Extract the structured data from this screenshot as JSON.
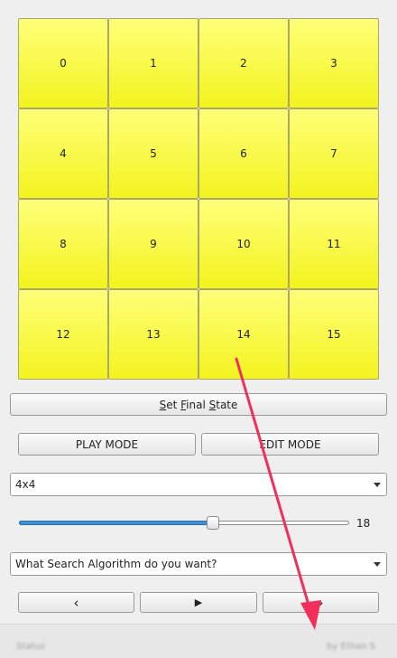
{
  "tiles": [
    "0",
    "1",
    "2",
    "3",
    "4",
    "5",
    "6",
    "7",
    "8",
    "9",
    "10",
    "11",
    "12",
    "13",
    "14",
    "15"
  ],
  "buttons": {
    "set_final_state": {
      "pre": "",
      "u1": "S",
      "mid1": "et ",
      "u2": "F",
      "mid2": "inal ",
      "u3": "S",
      "post": "tate"
    },
    "play_mode": "PLAY MODE",
    "edit_mode": "EDIT MODE"
  },
  "size_select": {
    "value": "4x4"
  },
  "speed_slider": {
    "value": "18",
    "fraction": 0.59
  },
  "algorithm_select": {
    "value": "What Search Algorithm do you want?"
  },
  "nav": {
    "prev_icon": "‹",
    "play_icon": "▶",
    "next_icon": "›"
  },
  "status": {
    "left": "Status",
    "right": "by Ethan S"
  },
  "colors": {
    "tile": "#f7f740",
    "accent": "#3d8fd6",
    "annotation": "#f0305a"
  }
}
